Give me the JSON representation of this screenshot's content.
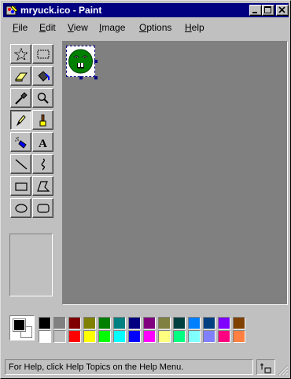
{
  "window": {
    "title": "mryuck.ico - Paint",
    "controls": [
      "minimize",
      "maximize",
      "close"
    ]
  },
  "menu": [
    {
      "id": "file",
      "label": "File"
    },
    {
      "id": "edit",
      "label": "Edit"
    },
    {
      "id": "view",
      "label": "View"
    },
    {
      "id": "image",
      "label": "Image"
    },
    {
      "id": "options",
      "label": "Options"
    },
    {
      "id": "help",
      "label": "Help"
    }
  ],
  "tools": [
    {
      "name": "free-form-select",
      "icon": "star-select-icon"
    },
    {
      "name": "select",
      "icon": "rect-select-icon"
    },
    {
      "name": "eraser",
      "icon": "eraser-icon"
    },
    {
      "name": "fill",
      "icon": "fill-bucket-icon"
    },
    {
      "name": "pick-color",
      "icon": "eyedropper-icon"
    },
    {
      "name": "magnifier",
      "icon": "magnifier-icon"
    },
    {
      "name": "pencil",
      "icon": "pencil-icon",
      "selected": true
    },
    {
      "name": "brush",
      "icon": "brush-icon"
    },
    {
      "name": "airbrush",
      "icon": "airbrush-icon"
    },
    {
      "name": "text",
      "icon": "text-icon",
      "glyph": "A"
    },
    {
      "name": "line",
      "icon": "line-icon"
    },
    {
      "name": "curve",
      "icon": "curve-icon"
    },
    {
      "name": "rectangle",
      "icon": "rectangle-icon"
    },
    {
      "name": "polygon",
      "icon": "polygon-icon"
    },
    {
      "name": "ellipse",
      "icon": "ellipse-icon"
    },
    {
      "name": "rounded-rectangle",
      "icon": "rounded-rect-icon"
    }
  ],
  "colors": {
    "foreground": "#000000",
    "background": "#ffffff",
    "row1": [
      "#000000",
      "#808080",
      "#800000",
      "#808000",
      "#008000",
      "#008080",
      "#000080",
      "#800080",
      "#808040",
      "#004040",
      "#0080ff",
      "#004080",
      "#8000ff",
      "#804000"
    ],
    "row2": [
      "#ffffff",
      "#c0c0c0",
      "#ff0000",
      "#ffff00",
      "#00ff00",
      "#00ffff",
      "#0000ff",
      "#ff00ff",
      "#ffff80",
      "#00ff80",
      "#80ffff",
      "#8080ff",
      "#ff0080",
      "#ff8040"
    ]
  },
  "status": {
    "help_text": "For Help, click Help Topics on the Help Menu."
  }
}
